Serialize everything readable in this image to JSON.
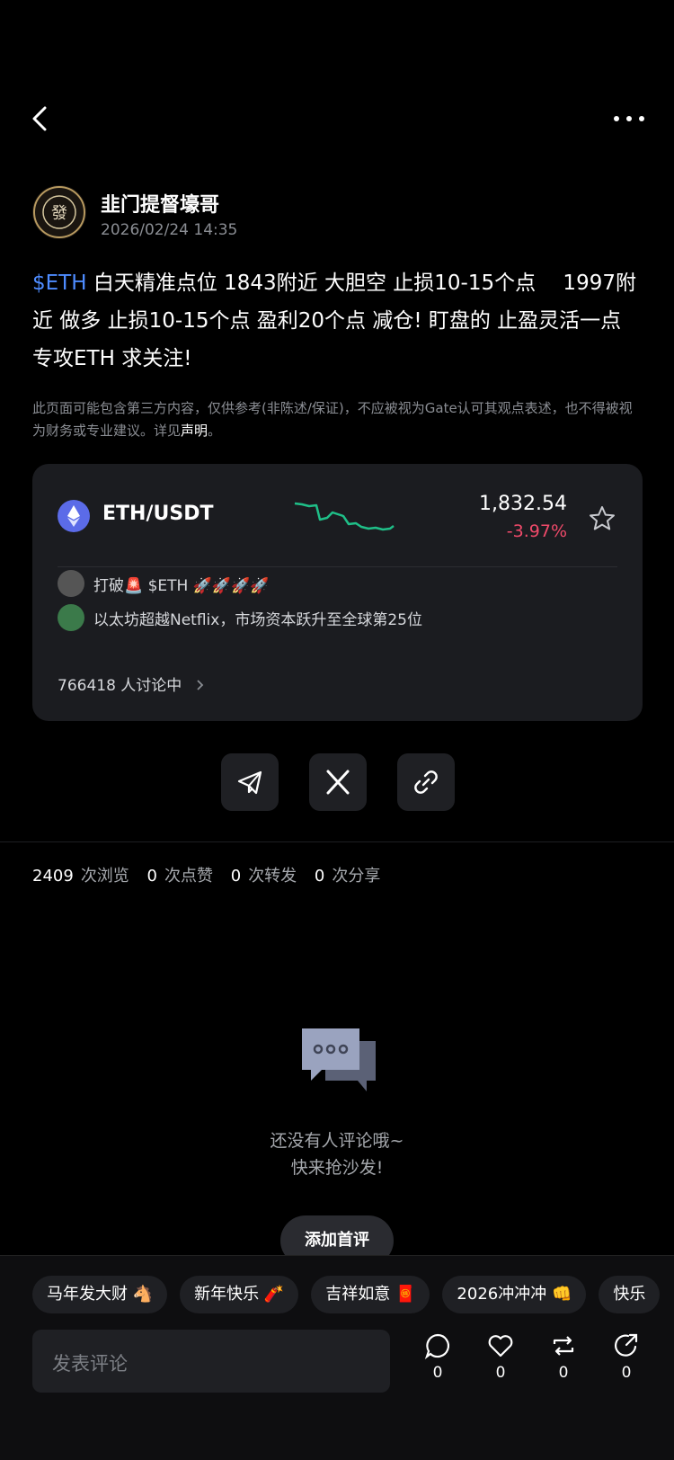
{
  "post": {
    "author": "韭门提督壕哥",
    "date": "2026/02/24 14:35",
    "tag": "$ETH",
    "text": "  白天精准点位  1843附近 大胆空 止损10-15个点  　1997附近 做多 止损10-15个点  盈利20个点 减仓!  盯盘的  止盈灵活一点   专攻ETH 求关注!",
    "disclaimer": "此页面可能包含第三方内容，仅供参考(非陈述/保证)，不应被视为Gate认可其观点表述，也不得被视为财务或专业建议。详见",
    "disclaimer_link": "声明",
    "disclaimer_end": "。"
  },
  "ticker": {
    "pair": "ETH/USDT",
    "price": "1,832.54",
    "change": "-3.97%",
    "posts": [
      {
        "text": "打破🚨 $ETH 🚀🚀🚀🚀"
      },
      {
        "text": "以太坊超越Netflix，市场资本跃升至全球第25位"
      }
    ],
    "discussing": "766418 人讨论中"
  },
  "stats": {
    "views": "2409",
    "views_label": "次浏览",
    "likes": "0",
    "likes_label": "次点赞",
    "reposts": "0",
    "reposts_label": "次转发",
    "shares": "0",
    "shares_label": "次分享"
  },
  "empty": {
    "line1": "还没有人评论哦~",
    "line2": "快来抢沙发!",
    "button": "添加首评"
  },
  "chips": [
    "马年发大财 🐴",
    "新年快乐 🧨",
    "吉祥如意 🧧",
    "2026冲冲冲 👊",
    "快乐"
  ],
  "composer": {
    "placeholder": "发表评论",
    "comments": "0",
    "likes": "0",
    "reposts": "0",
    "shares": "0"
  },
  "colors": {
    "accent": "#4e8cff",
    "down": "#f04a6a",
    "spark": "#1fbf88"
  }
}
